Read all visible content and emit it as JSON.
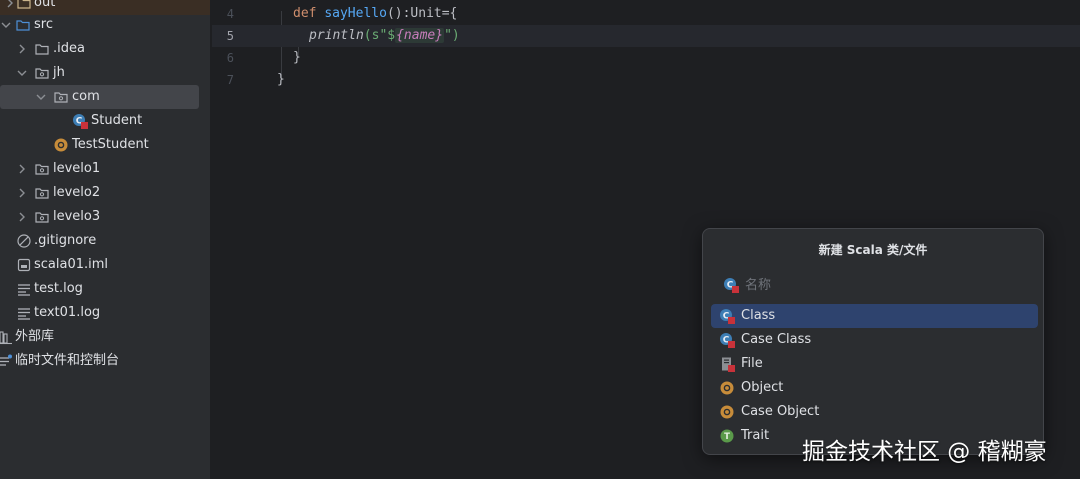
{
  "project_tree": {
    "items": [
      {
        "label": "out",
        "icon": "folder-icon"
      },
      {
        "label": "src",
        "icon": "source-folder-icon"
      },
      {
        "label": ".idea",
        "icon": "folder-icon"
      },
      {
        "label": "jh",
        "icon": "package-icon"
      },
      {
        "label": "com",
        "icon": "package-icon"
      },
      {
        "label": "Student",
        "icon": "scala-class-icon"
      },
      {
        "label": "TestStudent",
        "icon": "scala-object-icon"
      },
      {
        "label": "levelo1",
        "icon": "package-icon"
      },
      {
        "label": "levelo2",
        "icon": "package-icon"
      },
      {
        "label": "levelo3",
        "icon": "package-icon"
      },
      {
        "label": ".gitignore",
        "icon": "ignored-file-icon"
      },
      {
        "label": "scala01.iml",
        "icon": "module-file-icon"
      },
      {
        "label": "test.log",
        "icon": "text-file-icon"
      },
      {
        "label": "text01.log",
        "icon": "text-file-icon"
      },
      {
        "label": "外部库",
        "icon": "library-icon"
      },
      {
        "label": "临时文件和控制台",
        "icon": "scratches-icon"
      }
    ]
  },
  "editor": {
    "current_line": "5",
    "lines": [
      {
        "number": "4",
        "keyword": "def",
        "function": "sayHello",
        "rest": "():Unit={"
      },
      {
        "number": "5",
        "call": "println",
        "open": "(s\"$",
        "interp": "{name}",
        "close": "\")"
      },
      {
        "number": "6",
        "text": "}"
      },
      {
        "number": "7",
        "text": "}"
      }
    ]
  },
  "popup": {
    "title": "新建 Scala 类/文件",
    "search_placeholder": "名称",
    "items": [
      {
        "label": "Class",
        "icon": "scala-class-icon",
        "selected": true
      },
      {
        "label": "Case Class",
        "icon": "scala-case-class-icon",
        "selected": false
      },
      {
        "label": "File",
        "icon": "scala-file-icon",
        "selected": false
      },
      {
        "label": "Object",
        "icon": "scala-object-icon",
        "selected": false
      },
      {
        "label": "Case Object",
        "icon": "scala-case-object-icon",
        "selected": false
      },
      {
        "label": "Trait",
        "icon": "scala-trait-icon",
        "selected": false
      }
    ]
  },
  "watermark": "掘金技术社区 @ 稽糊豪",
  "colors": {
    "sidebar_bg": "#2b2d30",
    "editor_bg": "#1e1f22",
    "selection": "#2e436e",
    "keyword": "#cf8e6d",
    "function": "#56a8f5"
  }
}
